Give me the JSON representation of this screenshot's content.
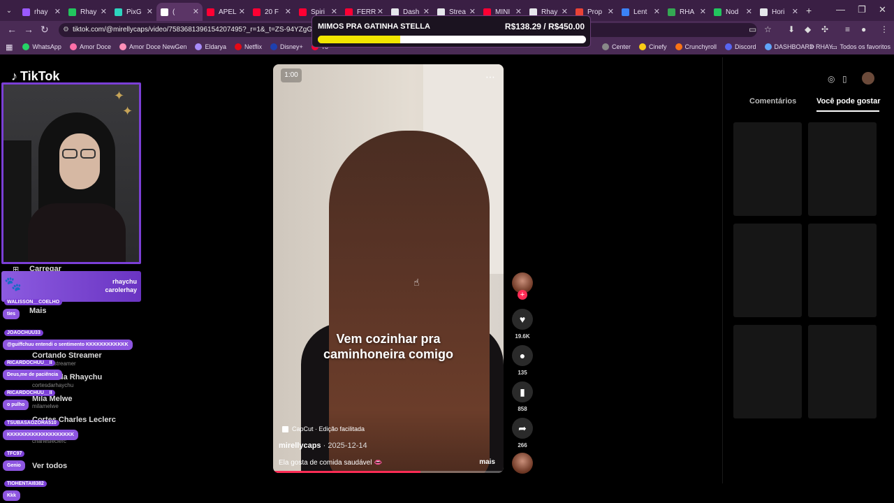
{
  "browser": {
    "tabs": [
      {
        "label": "rhay",
        "color": "#9b59ff"
      },
      {
        "label": "Rhay",
        "color": "#22c55e"
      },
      {
        "label": "PixG",
        "color": "#2dd4bf"
      },
      {
        "label": "(",
        "color": "#ffffff",
        "active": true
      },
      {
        "label": "APEL",
        "color": "#ff0033"
      },
      {
        "label": "20 F",
        "color": "#ff0033"
      },
      {
        "label": "Spiri",
        "color": "#ff0033"
      },
      {
        "label": "FERR",
        "color": "#ff0033"
      },
      {
        "label": "Dash",
        "color": "#e5e7eb"
      },
      {
        "label": "Strea",
        "color": "#e5e7eb"
      },
      {
        "label": "MINI",
        "color": "#ff0033"
      },
      {
        "label": "Rhay",
        "color": "#e5e7eb"
      },
      {
        "label": "Prop",
        "color": "#ea4335"
      },
      {
        "label": "Lent",
        "color": "#3b82f6"
      },
      {
        "label": "RHA",
        "color": "#34a853"
      },
      {
        "label": "Nod",
        "color": "#22c55e"
      },
      {
        "label": "Hori",
        "color": "#e5e7eb"
      }
    ],
    "new_tab": "+",
    "url": "tiktok.com/@mirellycaps/video/7583681396154207495?_r=1&_t=ZS-94YZgGSrxP2",
    "bookmarks": [
      {
        "label": "WhatsApp",
        "color": "#25d366"
      },
      {
        "label": "Amor Doce",
        "color": "#ff6fa8"
      },
      {
        "label": "Amor Doce NewGen",
        "color": "#ff8fb8"
      },
      {
        "label": "Eldarya",
        "color": "#a78bfa"
      },
      {
        "label": "Netflix",
        "color": "#e50914"
      },
      {
        "label": "Disney+",
        "color": "#1e40af"
      },
      {
        "label": "Yo",
        "color": "#ff0033"
      },
      {
        "label": "Center",
        "color": "#888888"
      },
      {
        "label": "Cinefy",
        "color": "#facc15"
      },
      {
        "label": "Crunchyroll",
        "color": "#f97316"
      },
      {
        "label": "Discord",
        "color": "#5865f2"
      },
      {
        "label": "DASHBOARD RHAY...",
        "color": "#60a5fa"
      }
    ],
    "bookmarks_more": "»",
    "all_favorites": "Todos os favoritos"
  },
  "goal_overlay": {
    "title": "MIMOS PRA GATINHA STELLA",
    "amount": "R$138.29 / R$450.00",
    "progress": 0.307
  },
  "tiktok": {
    "logo": "TikTok",
    "left_menu": {
      "upload": "Carregar",
      "more": "Mais",
      "following": [
        {
          "name": "Cortando Streamer",
          "sub": "cortandostreamer"
        },
        {
          "name": "Cortes da Rhaychu",
          "sub": "cortesdarhaychu"
        },
        {
          "name": "Mila Melwe",
          "sub": "milamelwe"
        },
        {
          "name": "Cortes Charles Leclerc",
          "sub": "charlesleclerc"
        }
      ],
      "see_all": "Ver todos"
    },
    "video": {
      "mute_label": "1:00",
      "caption_line1": "Vem cozinhar pra",
      "caption_line2": "caminhoneira comigo",
      "capcut": "CapCut · Edição facilitada",
      "author": "mirellycaps",
      "date": "· 2025-12-14",
      "description": "Ela gosta de comida saudável 👄",
      "more": "mais",
      "progress": 0.64
    },
    "actions": {
      "likes": "19.6K",
      "comments": "135",
      "saves": "858",
      "shares": "266"
    },
    "right_panel": {
      "tab_comments": "Comentários",
      "tab_suggested": "Você pode gostar"
    }
  },
  "stream_overlay": {
    "socials": [
      "rhaychu",
      "carolerhay"
    ],
    "chat": [
      {
        "user": "WALISSON__COELHO",
        "text": "ties"
      },
      {
        "user": "JOAOCHUU33",
        "text": "@guiffchuu entendi o sentimento KKKKKKKKKKKK"
      },
      {
        "user": "RICARDOCHUU__II",
        "text": "Deus,me de paciência"
      },
      {
        "user": "RICARDOCHUU__II",
        "text": "o pulho"
      },
      {
        "user": "TSUBASAOZORA510",
        "text": "KKKKKKKKKKKKKKKKKKK"
      },
      {
        "user": "TFC97",
        "text": "Genio"
      },
      {
        "user": "TIOHENTAI8382",
        "text": "Kkk"
      }
    ]
  }
}
